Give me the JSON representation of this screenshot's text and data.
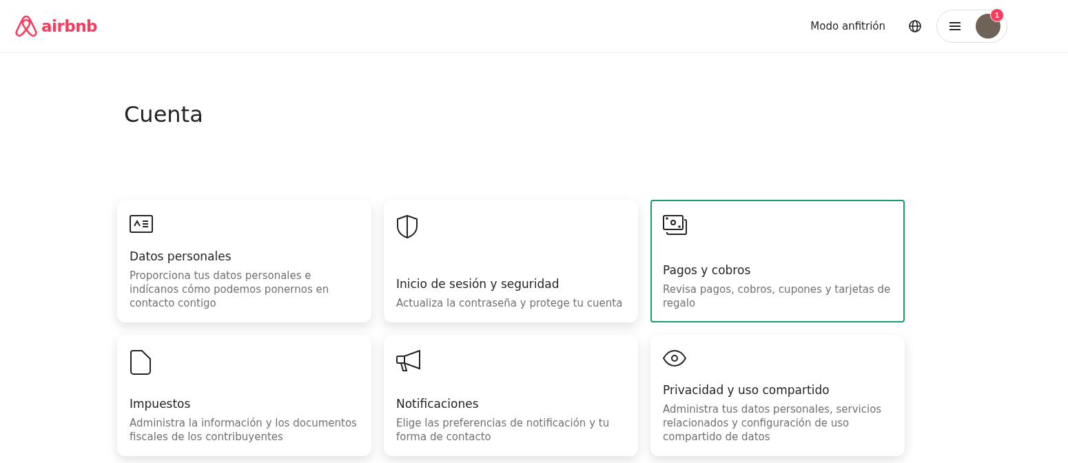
{
  "header": {
    "logo": "airbnb",
    "host_link": "Modo anfitrión",
    "notification_count": "1"
  },
  "page_title": "Cuenta",
  "cards": [
    {
      "title": "Datos personales",
      "description": "Proporciona tus datos personales e indícanos cómo podemos ponernos en contacto contigo",
      "selected": false
    },
    {
      "title": "Inicio de sesión y seguridad",
      "description": "Actualiza la contraseña y protege tu cuenta",
      "selected": false
    },
    {
      "title": "Pagos y cobros",
      "description": "Revisa pagos, cobros, cupones y tarjetas de regalo",
      "selected": true
    },
    {
      "title": "Impuestos",
      "description": "Administra la información y los documentos fiscales de los contribuyentes",
      "selected": false
    },
    {
      "title": "Notificaciones",
      "description": "Elige las preferencias de notificación y tu forma de contacto",
      "selected": false
    },
    {
      "title": "Privacidad y uso compartido",
      "description": "Administra tus datos personales, servicios relacionados y configuración de uso compartido de datos",
      "selected": false
    }
  ]
}
